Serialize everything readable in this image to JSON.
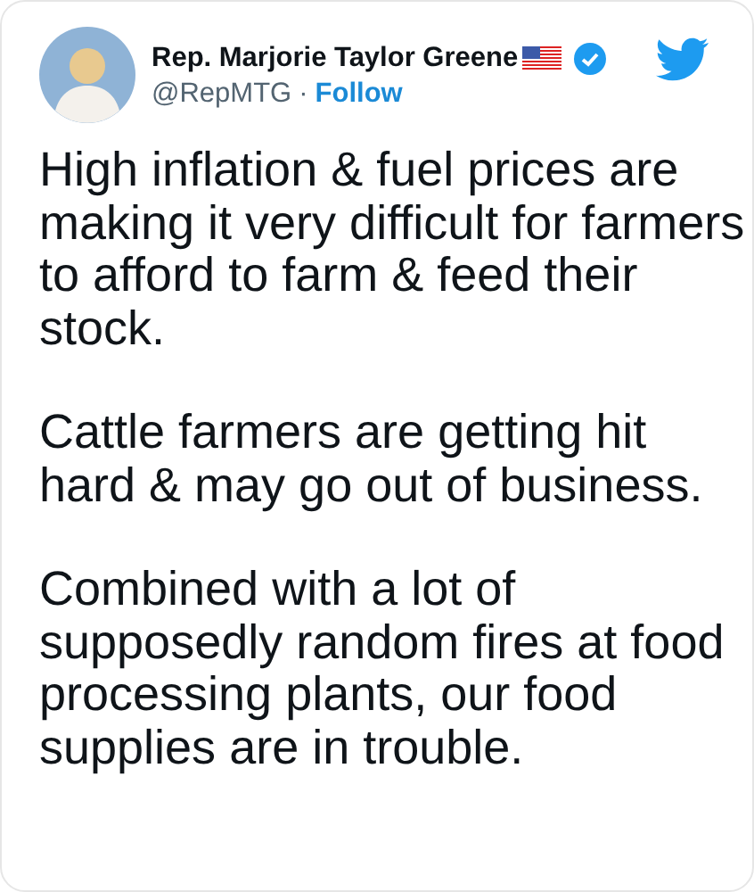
{
  "author": {
    "name": "Rep. Marjorie Taylor Greene",
    "handle": "@RepMTG",
    "separator": "·",
    "follow": "Follow",
    "verified": true
  },
  "paragraphs": [
    "High inflation & fuel prices are making it very difficult for farmers to afford to farm & feed their stock.",
    "Cattle farmers are getting hit hard & may go out of business.",
    "Combined with a lot of supposedly random fires at food processing plants, our food supplies are in trouble."
  ]
}
